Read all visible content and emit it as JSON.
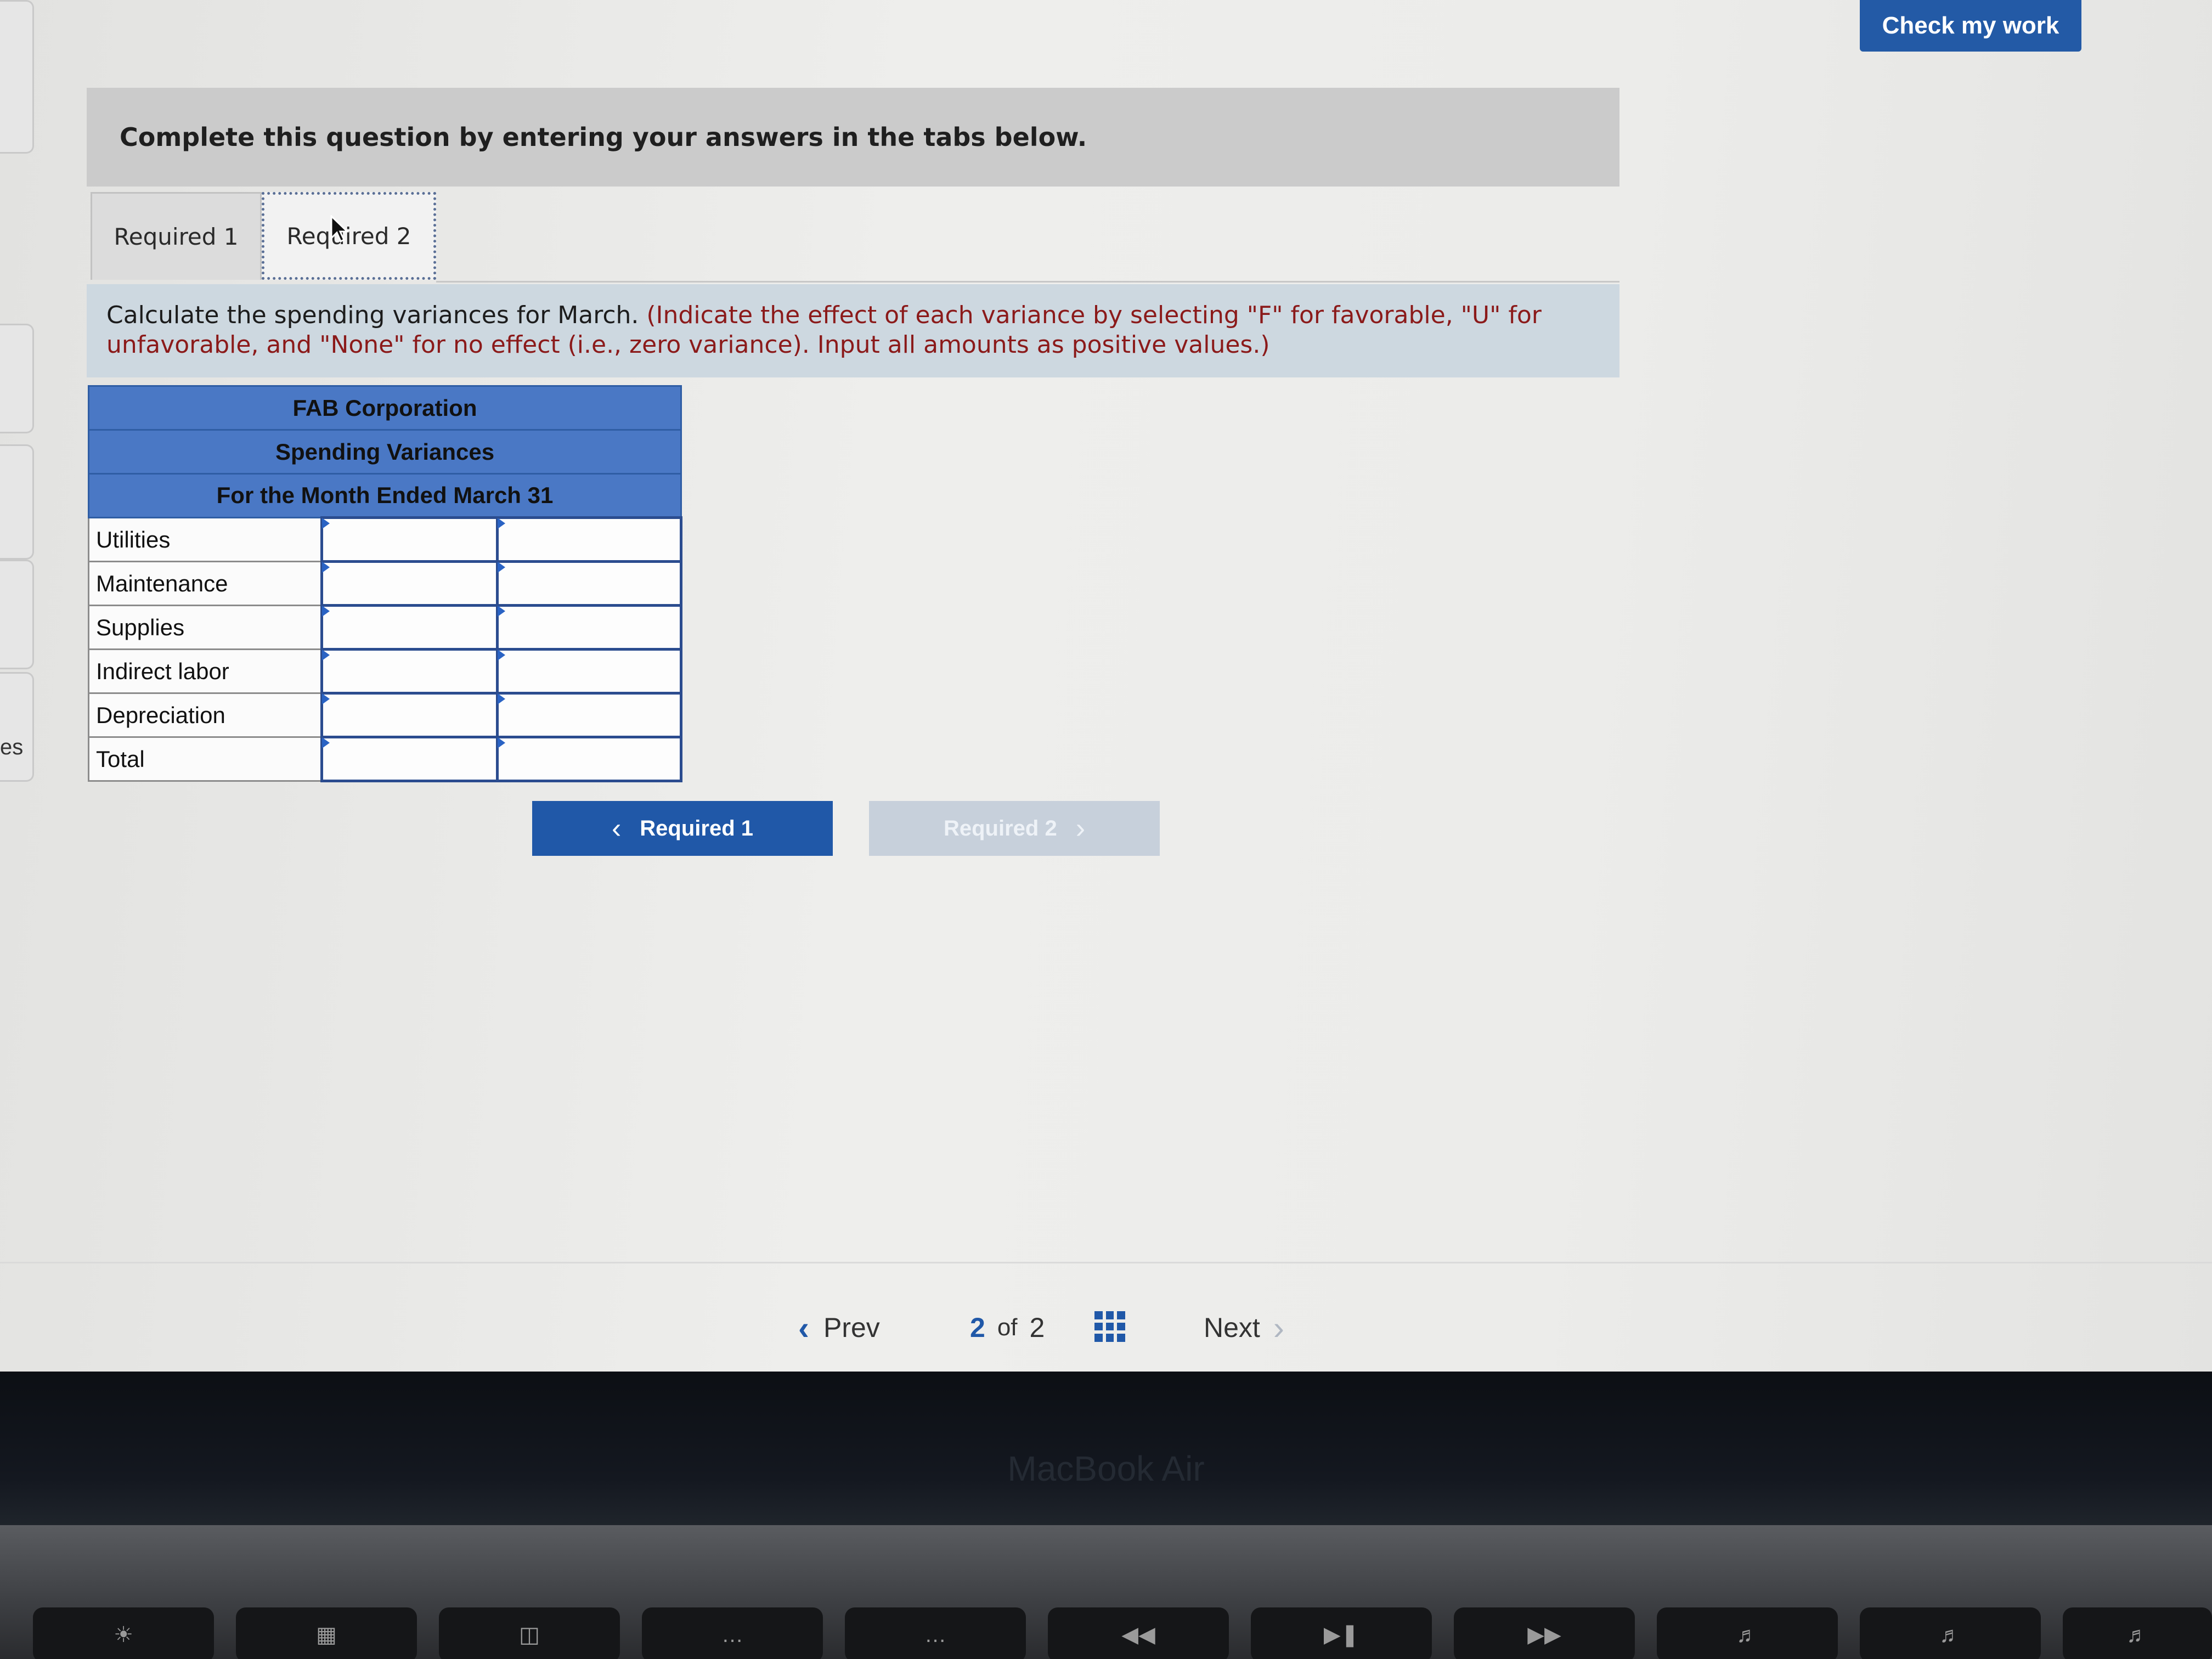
{
  "header": {
    "check_label": "Check my work"
  },
  "sidebar": {
    "partial_text": "es"
  },
  "instruction": "Complete this question by entering your answers in the tabs below.",
  "tabs": [
    {
      "label": "Required 1",
      "active": false
    },
    {
      "label": "Required 2",
      "active": true
    }
  ],
  "question": {
    "main": "Calculate the spending variances for March.",
    "note": "(Indicate the effect of each variance by selecting \"F\" for favorable, \"U\" for unfavorable, and \"None\" for no effect (i.e., zero variance). Input all amounts as positive values.)"
  },
  "report": {
    "company": "FAB Corporation",
    "title": "Spending Variances",
    "period": "For the Month Ended March 31",
    "rows": [
      "Utilities",
      "Maintenance",
      "Supplies",
      "Indirect labor",
      "Depreciation",
      "Total"
    ]
  },
  "nav": {
    "prev_label": "Required 1",
    "next_label": "Required 2"
  },
  "pager": {
    "prev": "Prev",
    "current": "2",
    "of": "of",
    "total": "2",
    "next": "Next"
  },
  "device": {
    "brand": "MacBook Air"
  },
  "colors": {
    "accent": "#2058a8",
    "header_blue": "#4a78c5",
    "question_bg": "#cdd8e0",
    "note_red": "#8b1a1a"
  }
}
